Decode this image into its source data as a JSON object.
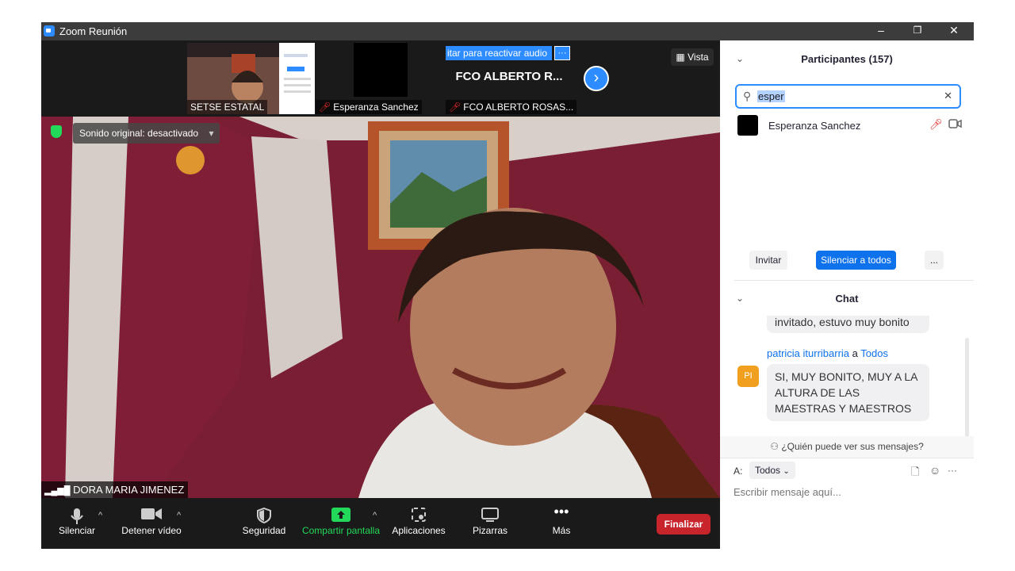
{
  "window": {
    "title": "Zoom Reunión",
    "minimize": "–",
    "restore": "❐",
    "close": "✕"
  },
  "strip": {
    "thumbs": [
      {
        "name": "SETSE ESTATAL"
      },
      {
        "name": "Esperanza Sanchez"
      },
      {
        "name": "FCO ALBERTO ROSAS...",
        "overlay_text": "FCO ALBERTO R...",
        "banner": "itar para reactivar audio",
        "more": "···"
      }
    ],
    "view_label": "Vista"
  },
  "main": {
    "sound_label": "Sonido original: desactivado",
    "speaker_name": "DORA MARIA JIMENEZ"
  },
  "toolbar": {
    "mute": "Silenciar",
    "video": "Detener vídeo",
    "security": "Seguridad",
    "share": "Compartir pantalla",
    "apps": "Aplicaciones",
    "whiteboards": "Pizarras",
    "more": "Más",
    "end": "Finalizar"
  },
  "participants": {
    "header": "Participantes (157)",
    "search_value": "esper",
    "list": [
      {
        "name": "Esperanza Sanchez"
      }
    ],
    "invite": "Invitar",
    "mute_all": "Silenciar a todos",
    "more": "..."
  },
  "chat": {
    "header": "Chat",
    "messages": [
      {
        "text": "invitado, estuvo muy bonito"
      },
      {
        "sender": "patricia iturribarria",
        "to_word": "a",
        "to": "Todos",
        "initials": "PI",
        "text": "SI, MUY BONITO, MUY A LA ALTURA DE LAS MAESTRAS Y MAESTROS"
      }
    ],
    "who_can_see": "¿Quién puede ver sus mensajes?",
    "to_label": "A:",
    "recipient": "Todos",
    "input_placeholder": "Escribir mensaje aquí...",
    "dots": "···"
  },
  "colors": {
    "accent": "#2d8cff",
    "end": "#c8242c",
    "share": "#23d959",
    "mic_off": "#e02828"
  }
}
